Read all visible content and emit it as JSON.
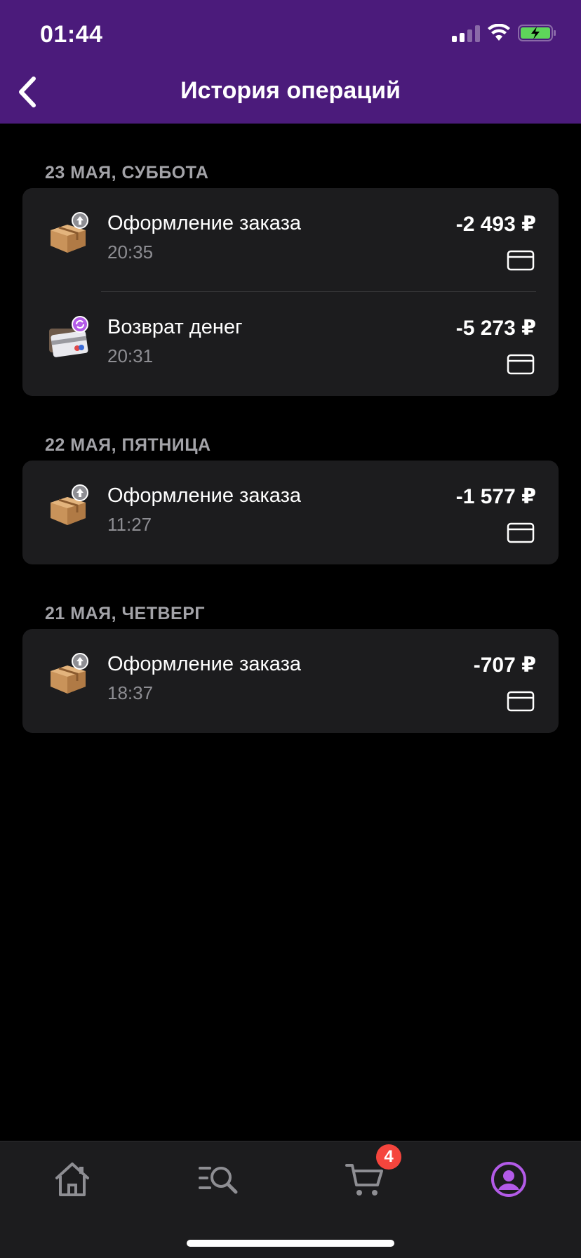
{
  "status_bar": {
    "time": "01:44"
  },
  "header": {
    "title": "История операций"
  },
  "groups": [
    {
      "date_label": "23 МАЯ, СУББОТА",
      "operations": [
        {
          "name": "Оформление заказа",
          "time": "20:35",
          "amount": "-2 493 ₽",
          "icon": "package-icon"
        },
        {
          "name": "Возврат денег",
          "time": "20:31",
          "amount": "-5 273 ₽",
          "icon": "refund-card-icon"
        }
      ]
    },
    {
      "date_label": "22 МАЯ, ПЯТНИЦА",
      "operations": [
        {
          "name": "Оформление заказа",
          "time": "11:27",
          "amount": "-1 577 ₽",
          "icon": "package-icon"
        }
      ]
    },
    {
      "date_label": "21 МАЯ, ЧЕТВЕРГ",
      "operations": [
        {
          "name": "Оформление заказа",
          "time": "18:37",
          "amount": "-707 ₽",
          "icon": "package-icon"
        }
      ]
    }
  ],
  "tabbar": {
    "items": [
      {
        "name": "home-icon"
      },
      {
        "name": "catalog-search-icon"
      },
      {
        "name": "cart-icon"
      },
      {
        "name": "profile-icon"
      }
    ],
    "cart_badge": "4",
    "active_color": "#b35be8"
  },
  "colors": {
    "header_bg": "#4b1b7b",
    "card_bg": "#1c1c1e",
    "accent": "#b35be8"
  }
}
